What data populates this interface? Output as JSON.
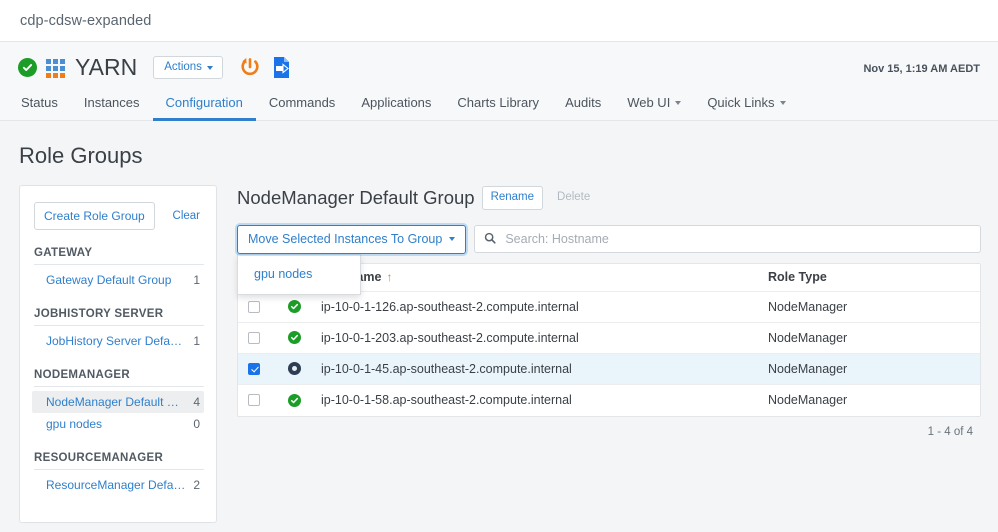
{
  "breadcrumb": {
    "cluster": "cdp-cdsw-expanded"
  },
  "service_header": {
    "health_icon": "check-circle-icon",
    "logo_icon": "yarn-grid-logo-icon",
    "name": "YARN",
    "actions_label": "Actions",
    "restart_icon": "restart-power-icon",
    "deploy_icon": "deploy-client-configuration-icon",
    "timestamp": "Nov 15, 1:19 AM AEDT"
  },
  "tabs": [
    {
      "label": "Status",
      "active": false,
      "caret": false
    },
    {
      "label": "Instances",
      "active": false,
      "caret": false
    },
    {
      "label": "Configuration",
      "active": true,
      "caret": false
    },
    {
      "label": "Commands",
      "active": false,
      "caret": false
    },
    {
      "label": "Applications",
      "active": false,
      "caret": false
    },
    {
      "label": "Charts Library",
      "active": false,
      "caret": false
    },
    {
      "label": "Audits",
      "active": false,
      "caret": false
    },
    {
      "label": "Web UI",
      "active": false,
      "caret": true
    },
    {
      "label": "Quick Links",
      "active": false,
      "caret": true
    }
  ],
  "page": {
    "title": "Role Groups"
  },
  "role_groups_panel": {
    "create_label": "Create Role Group",
    "clear_label": "Clear",
    "sections": [
      {
        "label": "GATEWAY",
        "items": [
          {
            "name": "Gateway Default Group",
            "count": "1",
            "selected": false
          }
        ]
      },
      {
        "label": "JOBHISTORY SERVER",
        "items": [
          {
            "name": "JobHistory Server Default Gr...",
            "count": "1",
            "selected": false
          }
        ]
      },
      {
        "label": "NODEMANAGER",
        "items": [
          {
            "name": "NodeManager Default Group",
            "count": "4",
            "selected": true
          },
          {
            "name": "gpu nodes",
            "count": "0",
            "selected": false
          }
        ]
      },
      {
        "label": "RESOURCEMANAGER",
        "items": [
          {
            "name": "ResourceManager Default Gr...",
            "count": "2",
            "selected": false
          }
        ]
      }
    ]
  },
  "detail": {
    "group_title": "NodeManager Default Group",
    "rename_label": "Rename",
    "delete_label": "Delete",
    "move_button_label": "Move Selected Instances To Group",
    "dropdown_open": true,
    "dropdown_items": [
      {
        "label": "gpu nodes"
      }
    ],
    "search": {
      "placeholder": "Search: Hostname",
      "value": "",
      "icon": "search-icon"
    },
    "table": {
      "columns": {
        "hostname": "Hostname",
        "role_type": "Role Type"
      },
      "sort_indicator": "↑",
      "rows": [
        {
          "checked": false,
          "status": "good",
          "hostname": "ip-10-0-1-126.ap-southeast-2.compute.internal",
          "role_type": "NodeManager"
        },
        {
          "checked": false,
          "status": "good",
          "hostname": "ip-10-0-1-203.ap-southeast-2.compute.internal",
          "role_type": "NodeManager"
        },
        {
          "checked": true,
          "status": "stopped",
          "hostname": "ip-10-0-1-45.ap-southeast-2.compute.internal",
          "role_type": "NodeManager"
        },
        {
          "checked": false,
          "status": "good",
          "hostname": "ip-10-0-1-58.ap-southeast-2.compute.internal",
          "role_type": "NodeManager"
        }
      ],
      "footer": "1 - 4 of 4"
    }
  },
  "colors": {
    "link": "#2f7fcc",
    "health_green": "#1c9d27",
    "accent_orange": "#f07d17",
    "selected_row": "#eaf5fb",
    "checkbox_blue": "#1a73e8"
  }
}
